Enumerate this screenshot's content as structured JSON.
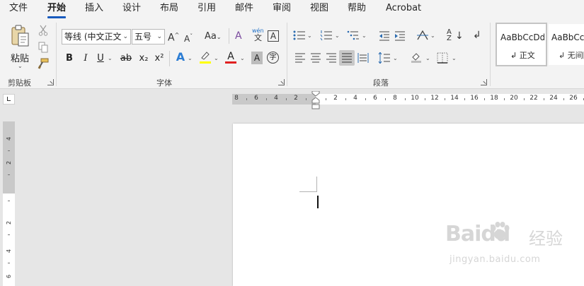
{
  "menu": {
    "tabs": [
      {
        "label": "文件"
      },
      {
        "label": "开始"
      },
      {
        "label": "插入"
      },
      {
        "label": "设计"
      },
      {
        "label": "布局"
      },
      {
        "label": "引用"
      },
      {
        "label": "邮件"
      },
      {
        "label": "审阅"
      },
      {
        "label": "视图"
      },
      {
        "label": "帮助"
      },
      {
        "label": "Acrobat"
      }
    ],
    "active_index": 1
  },
  "ribbon": {
    "clipboard": {
      "paste_label": "粘贴",
      "group_label": "剪贴板"
    },
    "font": {
      "font_name": "等线 (中文正文",
      "font_size": "五号",
      "group_label": "字体",
      "grow_glyph": "A^",
      "shrink_glyph": "Aˇ",
      "change_case": "Aa",
      "clear_format_glyph": "A",
      "phonetic_top": "wén",
      "phonetic_bottom": "文",
      "char_border": "A",
      "bold": "B",
      "italic": "I",
      "underline": "U",
      "strike": "ab",
      "subscript": "x₂",
      "superscript": "x²",
      "text_effect": "A",
      "font_color_glyph": "A",
      "shading": "A",
      "enclose": "字",
      "highlight_color": "#ffff00",
      "font_color": "#e02020"
    },
    "paragraph": {
      "group_label": "段落"
    },
    "styles": {
      "items": [
        {
          "sample": "AaBbCcDd",
          "name": "↲ 正文"
        },
        {
          "sample": "AaBbCcDd",
          "name": "↲ 无间隔"
        }
      ]
    }
  },
  "ruler": {
    "h_left_numbers": [
      "8",
      "6",
      "4",
      "2"
    ],
    "h_right_numbers": [
      "2",
      "4",
      "6",
      "8",
      "10",
      "12",
      "14",
      "16",
      "18",
      "20",
      "22",
      "24",
      "26"
    ],
    "v_top_numbers": [
      "4",
      "2"
    ],
    "v_bottom_numbers": [
      "2",
      "4",
      "6"
    ]
  },
  "watermark": {
    "brand": "Baidu",
    "cn": "经验",
    "url": "jingyan.baidu.com"
  },
  "colors": {
    "accent": "#185abd"
  }
}
